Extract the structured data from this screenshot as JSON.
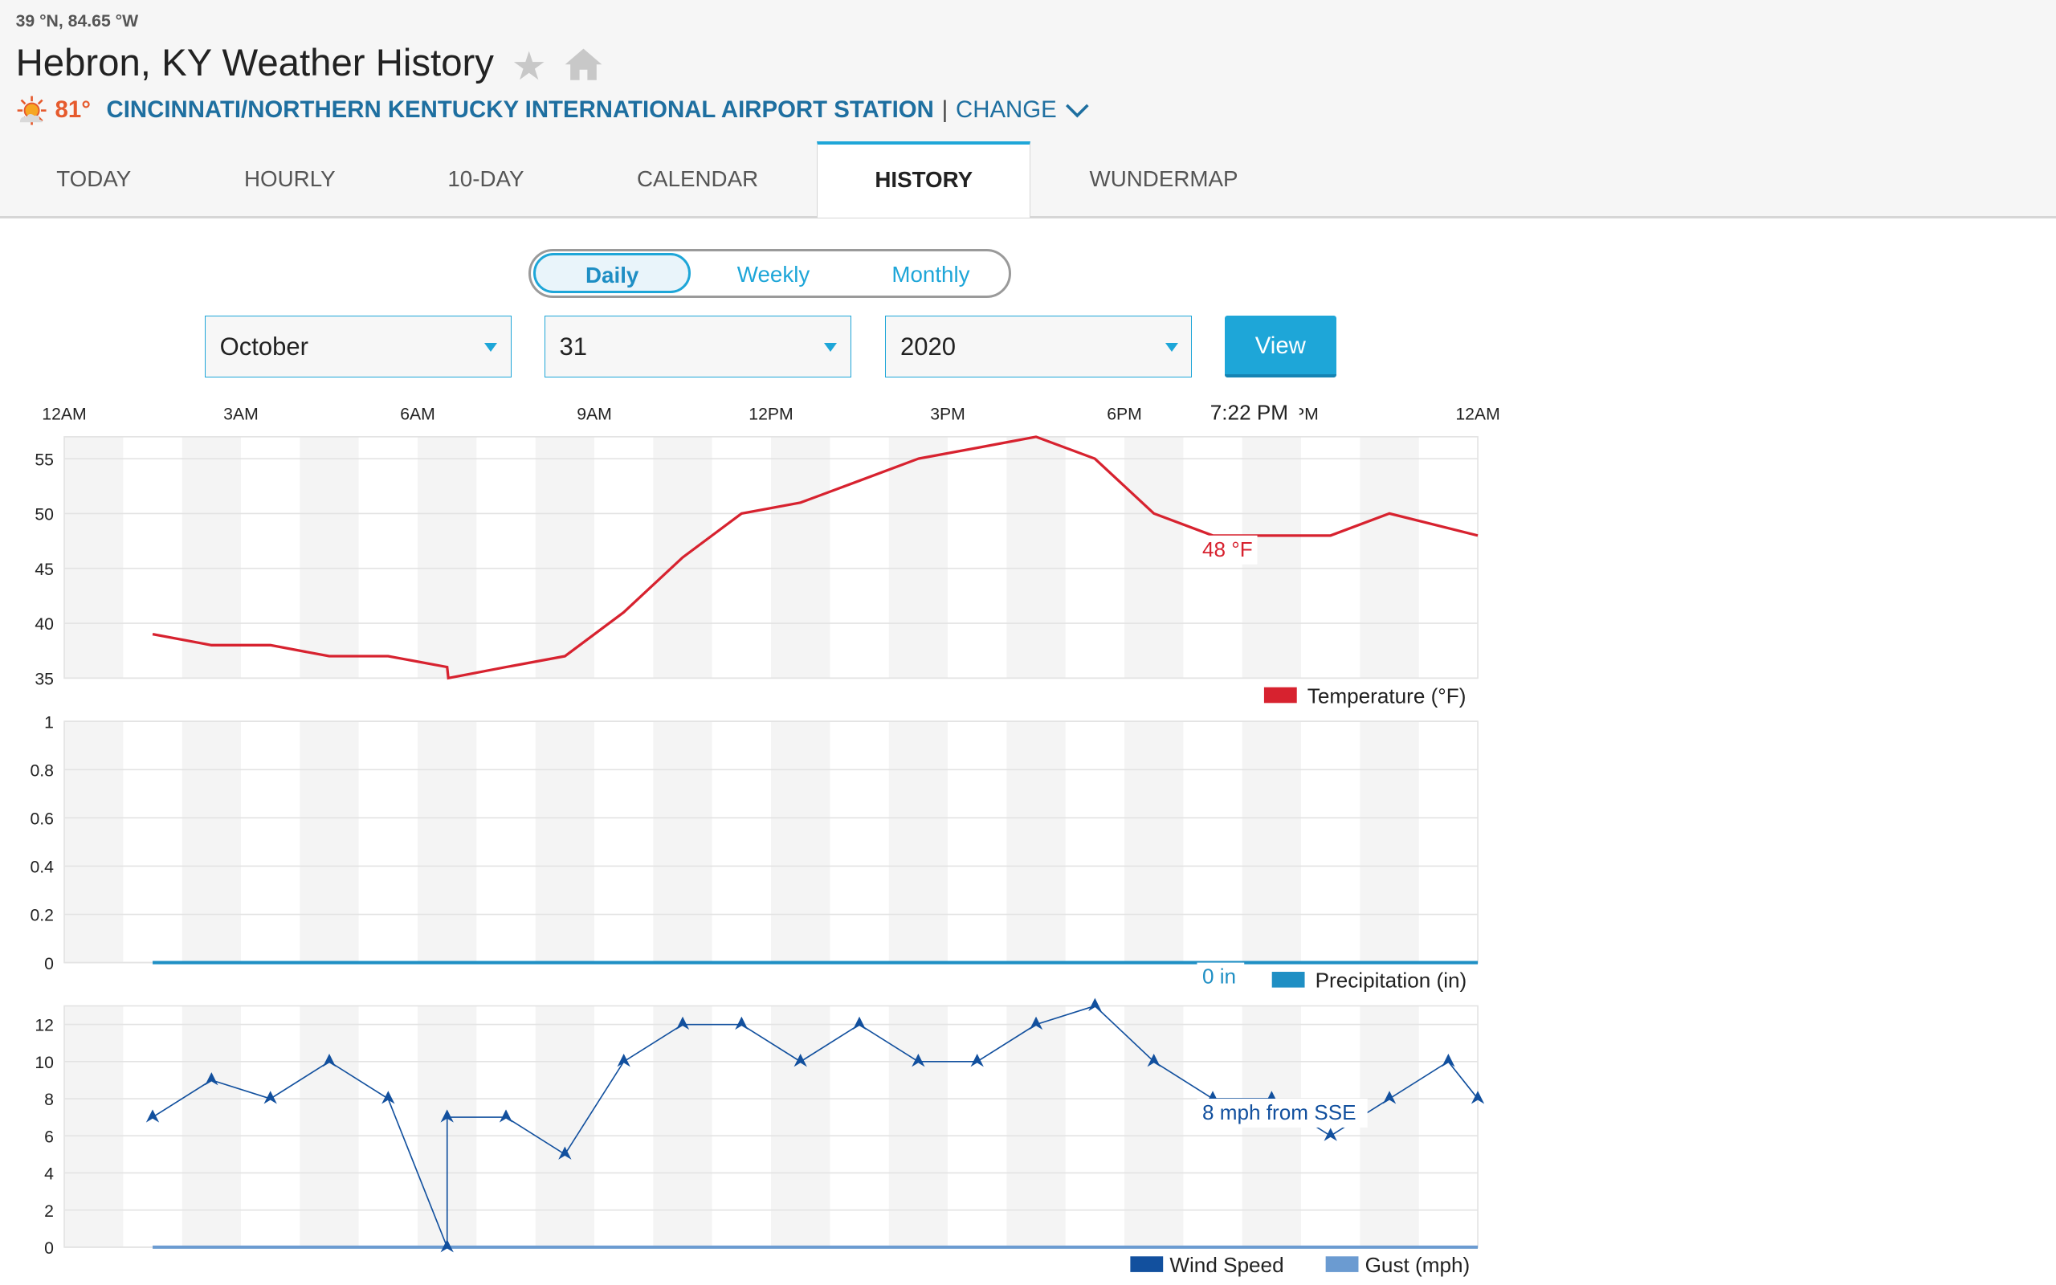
{
  "header": {
    "coords": "39 °N, 84.65 °W",
    "title": "Hebron, KY Weather History",
    "star_icon": "star-icon",
    "home_icon": "home-icon",
    "current_temp": "81°",
    "station": "CINCINNATI/NORTHERN KENTUCKY INTERNATIONAL AIRPORT STATION",
    "separator": "|",
    "change_label": "CHANGE"
  },
  "tabs": [
    {
      "label": "TODAY"
    },
    {
      "label": "HOURLY"
    },
    {
      "label": "10-DAY"
    },
    {
      "label": "CALENDAR"
    },
    {
      "label": "HISTORY",
      "active": true
    },
    {
      "label": "WUNDERMAP"
    }
  ],
  "period": {
    "options": [
      "Daily",
      "Weekly",
      "Monthly"
    ],
    "selected": "Daily"
  },
  "date": {
    "month": "October",
    "day": "31",
    "year": "2020",
    "view_label": "View"
  },
  "colors": {
    "accent": "#1ea6d8",
    "temperature": "#d7222f",
    "precip": "#1f8fc4",
    "wind": "#12509e",
    "gust": "#6b9bd1"
  },
  "chart_data": [
    {
      "type": "line",
      "x_ticks": [
        "12AM",
        "3AM",
        "6AM",
        "9AM",
        "12PM",
        "3PM",
        "6PM",
        "9PM",
        "12AM"
      ],
      "crosshair_time": "7:22 PM",
      "series": [
        {
          "name": "Temperature (°F)",
          "x_hours": [
            1.5,
            2.5,
            3.5,
            4.5,
            5.5,
            6.5,
            6.52,
            7.5,
            8.5,
            9.5,
            10.5,
            11.5,
            12.5,
            13.5,
            14.5,
            15.5,
            16.5,
            17.5,
            18.5,
            19.5,
            20.5,
            21.5,
            22.5,
            24
          ],
          "values": [
            39,
            38,
            38,
            37,
            37,
            36,
            35,
            36,
            37,
            41,
            46,
            50,
            51,
            53,
            55,
            56,
            57,
            55,
            50,
            48,
            48,
            48,
            50,
            48
          ]
        }
      ],
      "ylim": [
        35,
        57
      ],
      "y_ticks": [
        35,
        40,
        45,
        50,
        55
      ],
      "tooltip": "48 °F",
      "legend": "bottom-right"
    },
    {
      "type": "line",
      "series": [
        {
          "name": "Precipitation (in)",
          "x_hours": [
            1.5,
            24
          ],
          "values": [
            0,
            0
          ]
        }
      ],
      "ylim": [
        0,
        1
      ],
      "y_ticks": [
        "0",
        "0.2",
        "0.4",
        "0.6",
        "0.8",
        "1"
      ],
      "tooltip": "0 in",
      "legend": "bottom-right"
    },
    {
      "type": "line",
      "series": [
        {
          "name": "Wind Speed",
          "x_hours": [
            1.5,
            2.5,
            3.5,
            4.5,
            5.5,
            6.5,
            6.5,
            7.5,
            8.5,
            9.5,
            10.5,
            11.5,
            12.5,
            13.5,
            14.5,
            15.5,
            16.5,
            17.5,
            18.5,
            19.5,
            20.5,
            21.5,
            22.5,
            23.5,
            24
          ],
          "values": [
            7,
            9,
            8,
            10,
            8,
            0,
            7,
            7,
            5,
            10,
            12,
            12,
            10,
            12,
            10,
            10,
            12,
            13,
            10,
            8,
            8,
            6,
            8,
            10,
            8
          ]
        },
        {
          "name": "Gust (mph)",
          "x_hours": [
            1.5,
            24
          ],
          "values": [
            0,
            0
          ]
        }
      ],
      "ylim": [
        0,
        13
      ],
      "y_ticks": [
        0,
        2,
        4,
        6,
        8,
        10,
        12
      ],
      "tooltip": "8 mph from SSE",
      "legend": "bottom-right"
    }
  ]
}
